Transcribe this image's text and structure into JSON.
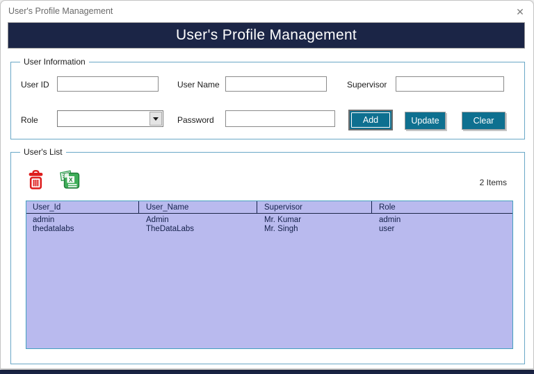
{
  "window": {
    "title": "User's Profile Management",
    "close_glyph": "✕"
  },
  "header": {
    "title": "User's Profile Management"
  },
  "user_information": {
    "legend": "User Information",
    "fields": [
      {
        "label": "User ID",
        "value": "",
        "type": "text"
      },
      {
        "label": "User Name",
        "value": "",
        "type": "text"
      },
      {
        "label": "Supervisor",
        "value": "",
        "type": "text"
      },
      {
        "label": "Role",
        "value": "",
        "type": "combobox"
      },
      {
        "label": "Password",
        "value": "",
        "type": "text"
      }
    ],
    "buttons": [
      {
        "label": "Add"
      },
      {
        "label": "Update"
      },
      {
        "label": "Clear"
      }
    ]
  },
  "users_list": {
    "legend": "User's List",
    "icons": [
      {
        "name": "delete-icon"
      },
      {
        "name": "export-to-excel-icon"
      }
    ],
    "items_count": "2 Items",
    "table": {
      "columns": [
        "User_Id",
        "User_Name",
        "Supervisor",
        "Role"
      ],
      "rows": [
        [
          "admin",
          "Admin",
          "Mr. Kumar",
          "admin"
        ],
        [
          "thedatalabs",
          "TheDataLabs",
          "Mr. Singh",
          "user"
        ]
      ]
    }
  },
  "colors": {
    "banner_bg": "#1b2546",
    "banner_text": "#ffffff",
    "button_bg": "#0e7090",
    "button_text": "#ffffff",
    "group_border": "#69a7c6",
    "list_bg": "#b9baee",
    "list_border": "#45a0bf",
    "list_text": "#14204a",
    "delete_icon": "#de1e1e",
    "excel_icon_green": "#2e9e4f"
  }
}
